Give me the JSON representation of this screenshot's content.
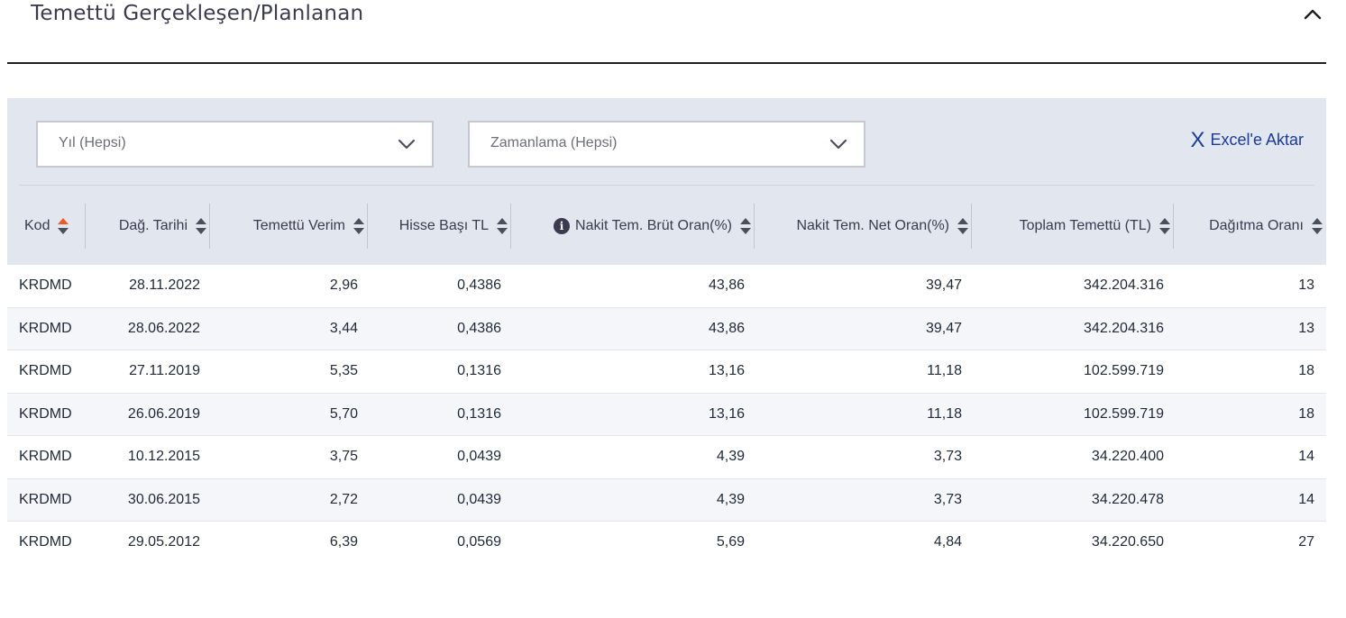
{
  "section": {
    "title": "Temettü Gerçekleşen/Planlanan"
  },
  "filters": {
    "year": {
      "value": "Yıl (Hepsi)"
    },
    "timing": {
      "value": "Zamanlama (Hepsi)"
    }
  },
  "export": {
    "icon_glyph": "X",
    "label": "Excel'e Aktar"
  },
  "colors": {
    "accent": "#1a3a9e",
    "active_sort": "#f05a22",
    "panel_bg": "#e2e6ef"
  },
  "table": {
    "columns": [
      {
        "label": "Kod",
        "active_sort": true
      },
      {
        "label": "Dağ. Tarihi",
        "active_sort": false
      },
      {
        "label": "Temettü Verim",
        "active_sort": false
      },
      {
        "label": "Hisse Başı TL",
        "active_sort": false
      },
      {
        "label": "Nakit Tem. Brüt Oran(%)",
        "active_sort": false,
        "info_icon": "i"
      },
      {
        "label": "Nakit Tem. Net Oran(%)",
        "active_sort": false
      },
      {
        "label": "Toplam Temettü (TL)",
        "active_sort": false
      },
      {
        "label": "Dağıtma Oranı",
        "active_sort": false
      }
    ],
    "rows": [
      [
        "KRDMD",
        "28.11.2022",
        "2,96",
        "0,4386",
        "43,86",
        "39,47",
        "342.204.316",
        "13"
      ],
      [
        "KRDMD",
        "28.06.2022",
        "3,44",
        "0,4386",
        "43,86",
        "39,47",
        "342.204.316",
        "13"
      ],
      [
        "KRDMD",
        "27.11.2019",
        "5,35",
        "0,1316",
        "13,16",
        "11,18",
        "102.599.719",
        "18"
      ],
      [
        "KRDMD",
        "26.06.2019",
        "5,70",
        "0,1316",
        "13,16",
        "11,18",
        "102.599.719",
        "18"
      ],
      [
        "KRDMD",
        "10.12.2015",
        "3,75",
        "0,0439",
        "4,39",
        "3,73",
        "34.220.400",
        "14"
      ],
      [
        "KRDMD",
        "30.06.2015",
        "2,72",
        "0,0439",
        "4,39",
        "3,73",
        "34.220.478",
        "14"
      ],
      [
        "KRDMD",
        "29.05.2012",
        "6,39",
        "0,0569",
        "5,69",
        "4,84",
        "34.220.650",
        "27"
      ]
    ]
  }
}
